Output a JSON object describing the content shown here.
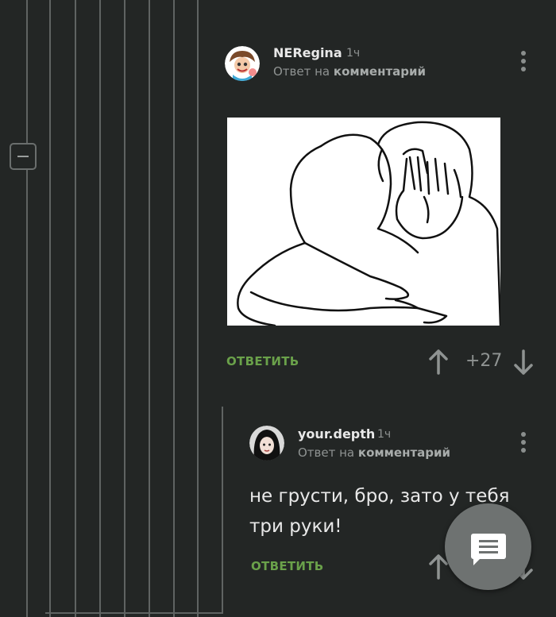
{
  "comment_1": {
    "author": "NERegina",
    "time": "1ч",
    "reply_prefix": "Ответ на",
    "reply_target": "комментарий",
    "reply_label": "ОТВЕТИТЬ",
    "rating": "+27"
  },
  "comment_2": {
    "author": "your.depth",
    "time": "1ч",
    "reply_prefix": "Ответ на",
    "reply_target": "комментарий",
    "text": "не грусти, бро, зато у тебя три руки!",
    "reply_label": "ОТВЕТИТЬ"
  },
  "icons": {
    "collapse": "minus-square-icon",
    "menu": "kebab-menu-icon",
    "upvote": "arrow-up-icon",
    "downvote": "arrow-down-icon",
    "fab": "message-icon"
  },
  "colors": {
    "background": "#232625",
    "accent_green": "#6aa14a",
    "thread_line": "#5f6362"
  }
}
